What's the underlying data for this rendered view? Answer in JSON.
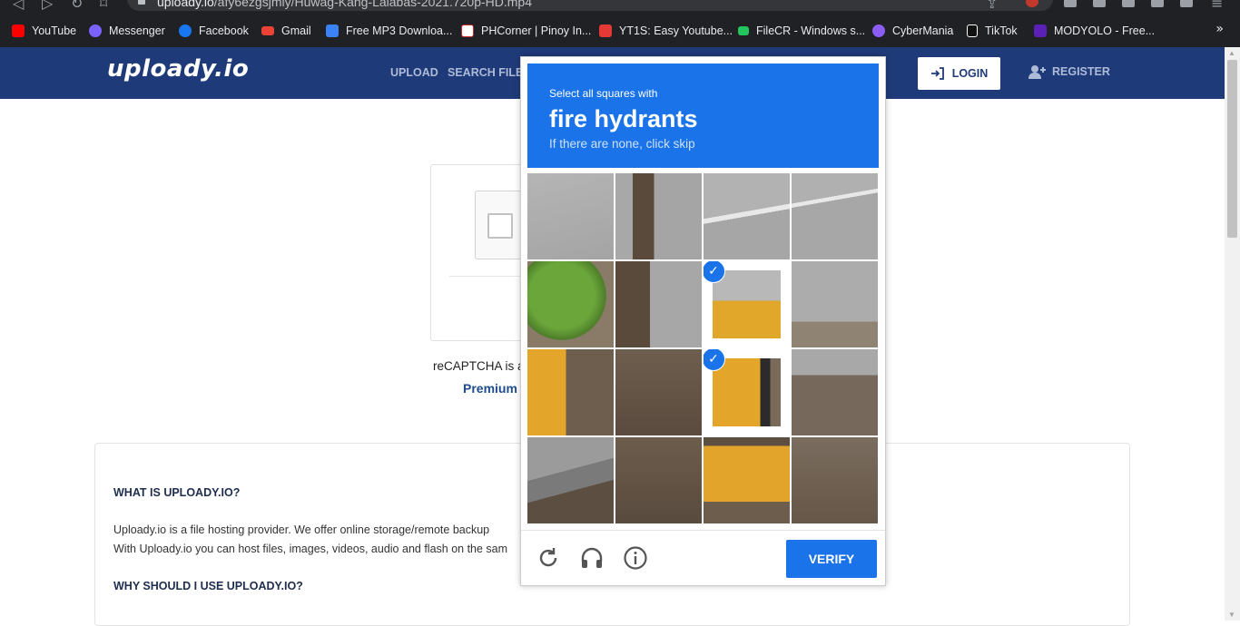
{
  "browser": {
    "url_domain": "uploady.io",
    "url_path": "/afy6ezgsjmly/Huwag-Kang-Lalabas-2021.720p-HD.mp4",
    "bookmarks": [
      {
        "label": "YouTube",
        "color": "#ff0000"
      },
      {
        "label": "Messenger",
        "color": "#7b61ff"
      },
      {
        "label": "Facebook",
        "color": "#1877f2"
      },
      {
        "label": "Gmail",
        "color": "#ea4335"
      },
      {
        "label": "Free MP3 Downloa...",
        "color": "#3b82f6"
      },
      {
        "label": "PHCorner | Pinoy In...",
        "color": "#ffffff"
      },
      {
        "label": "YT1S: Easy Youtube...",
        "color": "#e53935"
      },
      {
        "label": "FileCR - Windows s...",
        "color": "#22c55e"
      },
      {
        "label": "CyberMania",
        "color": "#8b5cf6"
      },
      {
        "label": "TikTok",
        "color": "#111111"
      },
      {
        "label": "MODYOLO - Free...",
        "color": "#5b21b6"
      }
    ],
    "more_label": "»"
  },
  "header": {
    "logo": "uploady.io",
    "nav": {
      "upload": "UPLOAD",
      "search": "SEARCH FILES"
    },
    "login": "LOGIN",
    "register": "REGISTER"
  },
  "main": {
    "recaptcha_text": "reCAPTCHA is a",
    "premium": "Premium",
    "info": {
      "h1": "WHAT IS UPLOADY.IO?",
      "p1": "Uploady.io is a file hosting provider. We offer online storage/remote backup",
      "p2": "With Uploady.io you can host files, images, videos, audio and flash on the sam",
      "h2": "WHY SHOULD I USE UPLOADY.IO?"
    }
  },
  "challenge": {
    "instruction": "Select all squares with",
    "target": "fire hydrants",
    "hint": "If there are none, click skip",
    "verify": "VERIFY",
    "selected_tiles": [
      6,
      10
    ],
    "accent": "#1a73e8"
  }
}
